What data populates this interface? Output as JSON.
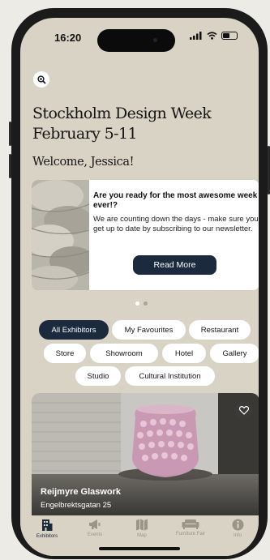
{
  "status": {
    "time": "16:20"
  },
  "header": {
    "title_line1": "Stockholm Design Week",
    "title_line2": "February 5-11",
    "welcome": "Welcome, Jessica!"
  },
  "promo": {
    "heading": "Are you ready for the most awesome week ever!?",
    "body": "We are counting down the days - make sure you get up to date by subscribing to our newsletter.",
    "button_label": "Read More"
  },
  "pagination": {
    "count": 2,
    "active": 1
  },
  "filters": [
    {
      "label": "All Exhibitors",
      "active": true
    },
    {
      "label": "My Favourites",
      "active": false
    },
    {
      "label": "Restaurant",
      "active": false
    },
    {
      "label": "Store",
      "active": false
    },
    {
      "label": "Showroom",
      "active": false
    },
    {
      "label": "Hotel",
      "active": false
    },
    {
      "label": "Gallery",
      "active": false
    },
    {
      "label": "Studio",
      "active": false
    },
    {
      "label": "Cultural Institution",
      "active": false
    }
  ],
  "exhibitor_card": {
    "name": "Reijmyre Glaswork",
    "address": "Engelbrektsgatan 25"
  },
  "tabbar": [
    {
      "label": "Exhibitors",
      "icon": "building-icon",
      "active": true
    },
    {
      "label": "Events",
      "icon": "megaphone-icon",
      "active": false
    },
    {
      "label": "Map",
      "icon": "map-icon",
      "active": false
    },
    {
      "label": "Furniture Fair",
      "icon": "sofa-icon",
      "active": false
    },
    {
      "label": "Info",
      "icon": "info-icon",
      "active": false
    }
  ],
  "colors": {
    "background": "#d8d3c4",
    "accent": "#1b2a3d",
    "inactive": "#9a9588"
  }
}
